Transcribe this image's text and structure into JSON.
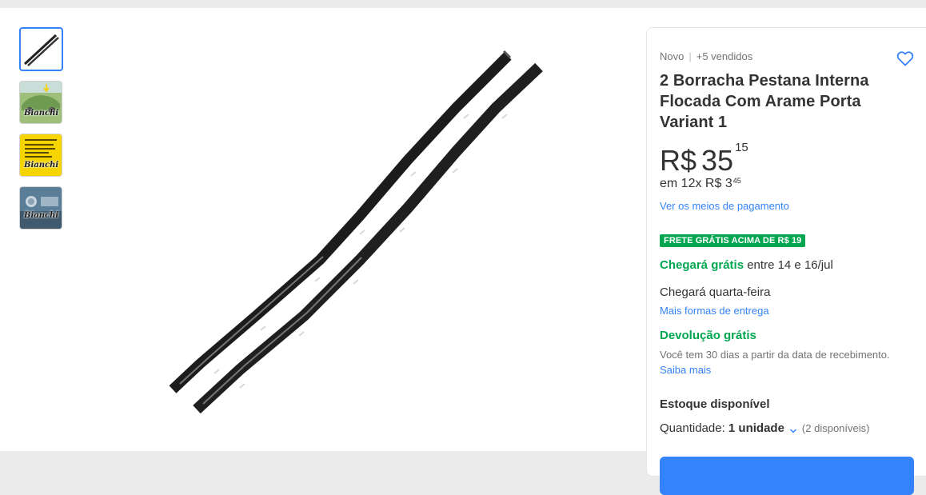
{
  "thumbnails": [
    {
      "name": "thumb-rubber-strips",
      "active": true
    },
    {
      "name": "thumb-car-photo",
      "label": "Bianchi"
    },
    {
      "name": "thumb-instructions",
      "label": "Bianchi"
    },
    {
      "name": "thumb-car-front",
      "label": "Bianchi"
    }
  ],
  "product": {
    "condition": "Novo",
    "sold": "+5 vendidos",
    "title": "2 Borracha Pestana Interna Flocada Com Arame Porta Variant 1",
    "currency": "R$",
    "price_int": "35",
    "price_cents": "15",
    "installments_prefix": "em 12x R$ 3",
    "installments_cents": "45",
    "payment_link": "Ver os meios de pagamento",
    "free_shipping_badge": "FRETE GRÁTIS ACIMA DE R$ 19",
    "arrival_green": "Chegará grátis",
    "arrival_rest": "entre 14 e 16/jul",
    "arrival2": "Chegará quarta-feira",
    "more_shipping_link": "Mais formas de entrega",
    "return_title": "Devolução grátis",
    "return_desc": "Você tem 30 dias a partir da data de recebimento.",
    "learn_more": "Saiba mais",
    "stock": "Estoque disponível",
    "quantity_label": "Quantidade:",
    "quantity_value": "1 unidade",
    "quantity_available": "(2 disponíveis)"
  },
  "colors": {
    "accent": "#3483fa",
    "green": "#00a650",
    "text": "#333333",
    "muted": "#737373"
  },
  "icons": {
    "favorite": "heart-outline-icon",
    "quantity": "chevron-down-icon"
  }
}
